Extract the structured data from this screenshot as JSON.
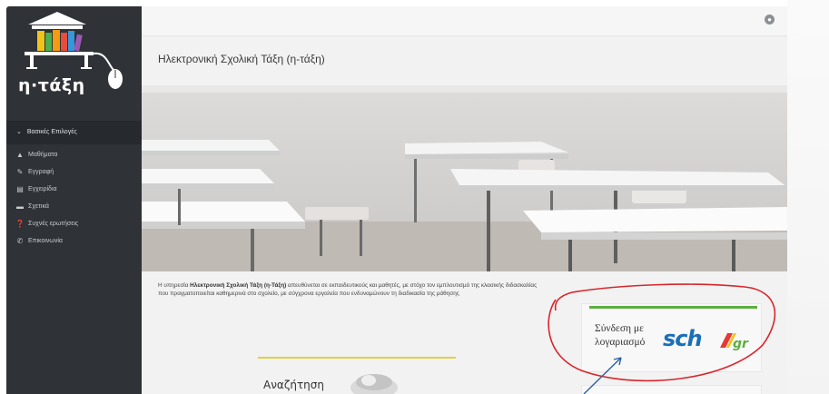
{
  "brand": {
    "logo_text": "η·τάξη"
  },
  "sidebar": {
    "section_header": "Βασικές Επιλογές",
    "items": [
      {
        "label": "Μαθήματα",
        "icon": "graduation-cap-icon"
      },
      {
        "label": "Εγγραφή",
        "icon": "edit-icon"
      },
      {
        "label": "Εγχειρίδια",
        "icon": "document-icon"
      },
      {
        "label": "Σχετικά",
        "icon": "card-icon"
      },
      {
        "label": "Συχνές ερωτήσεις",
        "icon": "question-icon"
      },
      {
        "label": "Επικοινωνία",
        "icon": "phone-icon"
      }
    ]
  },
  "topbar": {
    "globe_icon": "globe-icon"
  },
  "main": {
    "title": "Ηλεκτρονική Σχολική Τάξη (η-τάξη)",
    "intro": {
      "pre": "Η υπηρεσία ",
      "bold": "Ηλεκτρονική Σχολική Τάξη (η-Τάξη)",
      "post": " απευθύνεται σε εκπαιδευτικούς και μαθητές, με στόχο τον εμπλουτισμό της κλασικής διδασκαλίας που πραγματοποιείται καθημερινά στο σχολείο, με σύγχρονα εργαλεία που ενδυναμώνουν τη διαδικασία της μάθησης"
    },
    "search_label": "Αναζήτηση"
  },
  "login": {
    "label_line1": "Σύνδεση με",
    "label_line2": "λογαριασμό",
    "logo_text": "sch",
    "logo_suffix": "gr"
  },
  "colors": {
    "sidebar_bg": "#2f3237",
    "login_accent": "#5cae3f",
    "search_accent": "#e2cf44",
    "sch_blue": "#1a6fb7",
    "annotation_red": "#d8262b",
    "annotation_arrow": "#2a5ea8"
  }
}
